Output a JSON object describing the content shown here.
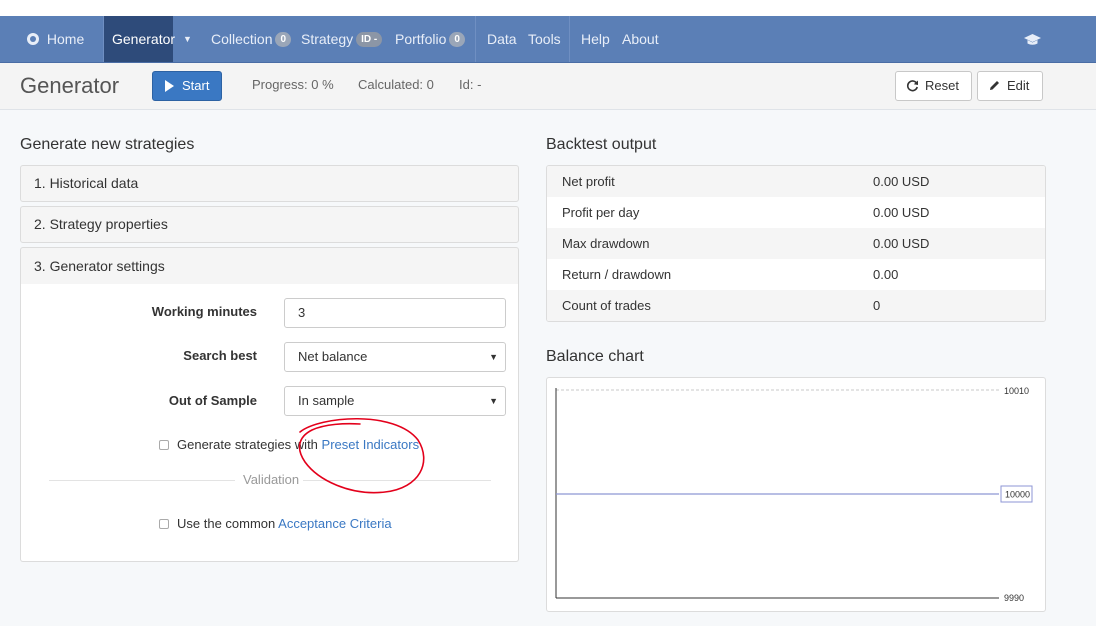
{
  "nav": {
    "home": "Home",
    "generator": "Generator",
    "collection": "Collection",
    "collection_badge": "0",
    "strategy": "Strategy",
    "strategy_badge": "ID -",
    "portfolio": "Portfolio",
    "portfolio_badge": "0",
    "data": "Data",
    "tools": "Tools",
    "help": "Help",
    "about": "About"
  },
  "toolbar": {
    "title": "Generator",
    "start_label": "Start",
    "progress": "Progress: 0 %",
    "calculated": "Calculated: 0",
    "id": "Id: -",
    "reset_label": "Reset",
    "edit_label": "Edit"
  },
  "generate": {
    "title": "Generate new strategies",
    "panels": [
      "1. Historical data",
      "2. Strategy properties",
      "3. Generator settings"
    ],
    "working_minutes_label": "Working minutes",
    "working_minutes_value": "3",
    "search_best_label": "Search best",
    "search_best_value": "Net balance",
    "out_of_sample_label": "Out of Sample",
    "out_of_sample_value": "In sample",
    "preset_text": "Generate strategies with ",
    "preset_link": "Preset Indicators",
    "validation_label": "Validation",
    "acceptance_text": "Use the common ",
    "acceptance_link": "Acceptance Criteria"
  },
  "backtest": {
    "title": "Backtest output",
    "rows": [
      {
        "name": "Net profit",
        "value": "0.00 USD"
      },
      {
        "name": "Profit per day",
        "value": "0.00 USD"
      },
      {
        "name": "Max drawdown",
        "value": "0.00 USD"
      },
      {
        "name": "Return / drawdown",
        "value": "0.00"
      },
      {
        "name": "Count of trades",
        "value": "0"
      }
    ]
  },
  "balance_chart": {
    "title": "Balance chart"
  },
  "chart_data": {
    "type": "line",
    "title": "Balance chart",
    "xlabel": "",
    "ylabel": "",
    "ylim": [
      9990,
      10010
    ],
    "y_tick_labels": [
      "10010",
      "9990"
    ],
    "current_value_label": "10000",
    "series": [
      {
        "values": [
          10000,
          10000
        ]
      }
    ],
    "grid": false
  },
  "colors": {
    "navbar": "#5b7fb6",
    "nav_active": "#2e4b7a",
    "primary_button": "#3a78c3",
    "link": "#3a78c3",
    "annotation": "#e3001b"
  },
  "icons": {
    "home": "home-icon",
    "dropdown": "chevron-down-icon",
    "graduation": "graduation-cap-icon",
    "start": "play-icon",
    "reset": "refresh-icon",
    "edit": "pencil-icon"
  }
}
